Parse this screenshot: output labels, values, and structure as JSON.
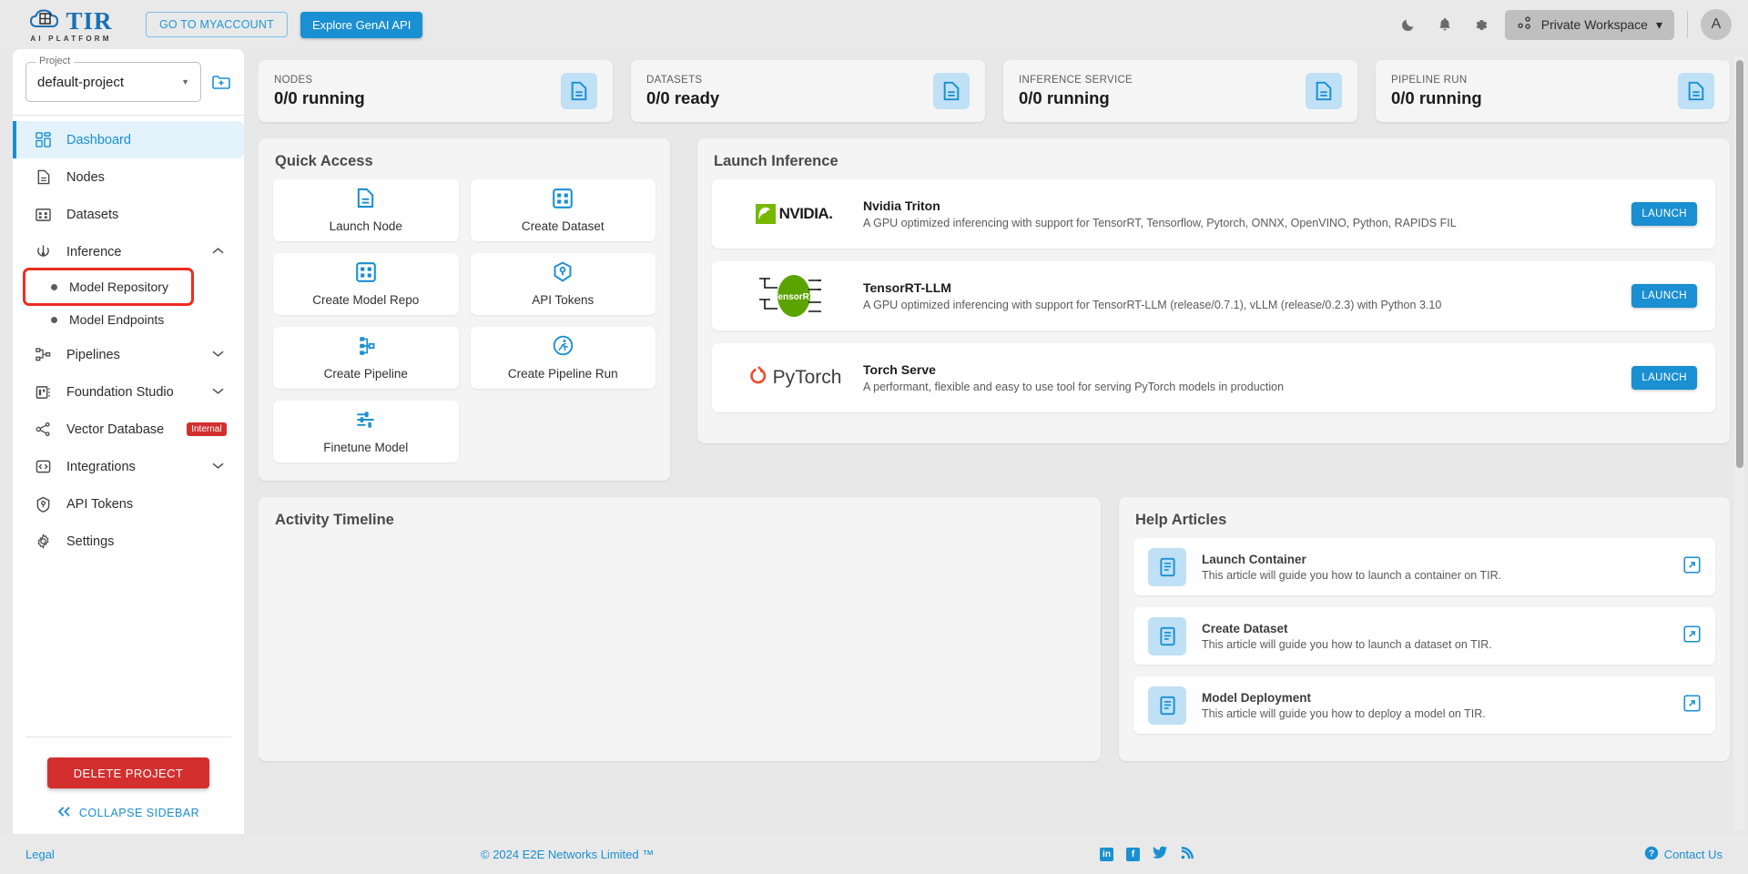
{
  "topbar": {
    "logo_text": "TIR",
    "logo_sub": "AI PLATFORM",
    "myaccount_label": "GO TO MYACCOUNT",
    "genai_label": "Explore GenAI API",
    "workspace_label": "Private Workspace",
    "avatar_initial": "A",
    "icons": [
      "dark-mode-icon",
      "notification-bell-icon",
      "settings-gear-icon"
    ]
  },
  "sidebar": {
    "project_legend": "Project",
    "project_value": "default-project",
    "items": [
      {
        "label": "Dashboard",
        "icon": "dashboard-grid-icon",
        "active": true
      },
      {
        "label": "Nodes",
        "icon": "node-document-icon"
      },
      {
        "label": "Datasets",
        "icon": "dataset-grid-icon"
      },
      {
        "label": "Inference",
        "icon": "inference-icon",
        "chevron": "up"
      },
      {
        "label": "Pipelines",
        "icon": "pipeline-icon",
        "chevron": "down"
      },
      {
        "label": "Foundation Studio",
        "icon": "foundation-studio-icon",
        "chevron": "down"
      },
      {
        "label": "Vector Database",
        "icon": "vector-db-icon",
        "badge": "Internal"
      },
      {
        "label": "Integrations",
        "icon": "integrations-code-icon",
        "chevron": "down"
      },
      {
        "label": "API Tokens",
        "icon": "api-token-icon"
      },
      {
        "label": "Settings",
        "icon": "settings-gear-icon"
      }
    ],
    "sub_items": [
      {
        "label": "Model Repository",
        "highlighted": true
      },
      {
        "label": "Model Endpoints",
        "highlighted": false
      }
    ],
    "delete_label": "DELETE PROJECT",
    "collapse_label": "COLLAPSE SIDEBAR"
  },
  "stats": [
    {
      "label": "NODES",
      "value": "0/0 running",
      "icon": "document-icon"
    },
    {
      "label": "DATASETS",
      "value": "0/0 ready",
      "icon": "document-icon"
    },
    {
      "label": "INFERENCE SERVICE",
      "value": "0/0 running",
      "icon": "document-icon"
    },
    {
      "label": "PIPELINE RUN",
      "value": "0/0 running",
      "icon": "document-icon"
    }
  ],
  "quick_access": {
    "title": "Quick Access",
    "tiles": [
      {
        "label": "Launch Node",
        "icon": "document-icon"
      },
      {
        "label": "Create Dataset",
        "icon": "grid-icon"
      },
      {
        "label": "Create Model Repo",
        "icon": "grid-icon"
      },
      {
        "label": "API Tokens",
        "icon": "cube-key-icon"
      },
      {
        "label": "Create Pipeline",
        "icon": "pipeline-icon"
      },
      {
        "label": "Create Pipeline Run",
        "icon": "runner-circle-icon"
      },
      {
        "label": "Finetune Model",
        "icon": "sliders-icon"
      }
    ]
  },
  "launch_inference": {
    "title": "Launch Inference",
    "items": [
      {
        "name": "Nvidia Triton",
        "desc": "A GPU optimized inferencing with support for TensorRT, Tensorflow, Pytorch, ONNX, OpenVINO, Python, RAPIDS FIL",
        "logo": "nvidia-logo",
        "logo_text": "NVIDIA.",
        "button": "LAUNCH"
      },
      {
        "name": "TensorRT-LLM",
        "desc": "A GPU optimized inferencing with support for TensorRT-LLM (release/0.7.1), vLLM (release/0.2.3) with Python 3.10",
        "logo": "tensorrt-logo",
        "logo_text": "TensorRT",
        "button": "LAUNCH"
      },
      {
        "name": "Torch Serve",
        "desc": "A performant, flexible and easy to use tool for serving PyTorch models in production",
        "logo": "pytorch-logo",
        "logo_text": "PyTorch",
        "button": "LAUNCH"
      }
    ]
  },
  "activity_timeline": {
    "title": "Activity Timeline"
  },
  "help_articles": {
    "title": "Help Articles",
    "items": [
      {
        "title": "Launch Container",
        "desc": "This article will guide you how to launch a container on TIR.",
        "icon": "article-document-icon",
        "link_icon": "external-link-icon"
      },
      {
        "title": "Create Dataset",
        "desc": "This article will guide you how to launch a dataset on TIR.",
        "icon": "article-document-icon",
        "link_icon": "external-link-icon"
      },
      {
        "title": "Model Deployment",
        "desc": "This article will guide you how to deploy a model on TIR.",
        "icon": "article-document-icon",
        "link_icon": "external-link-icon"
      }
    ]
  },
  "footer": {
    "legal": "Legal",
    "copyright": "© 2024 E2E Networks Limited ™",
    "social": [
      "linkedin-icon",
      "facebook-icon",
      "twitter-icon",
      "rss-icon"
    ],
    "contact": "Contact Us"
  },
  "colors": {
    "accent": "#1a8fd1",
    "danger": "#d32f2f",
    "highlight": "#ef2b20",
    "icon_bg": "#bfe0f5"
  }
}
